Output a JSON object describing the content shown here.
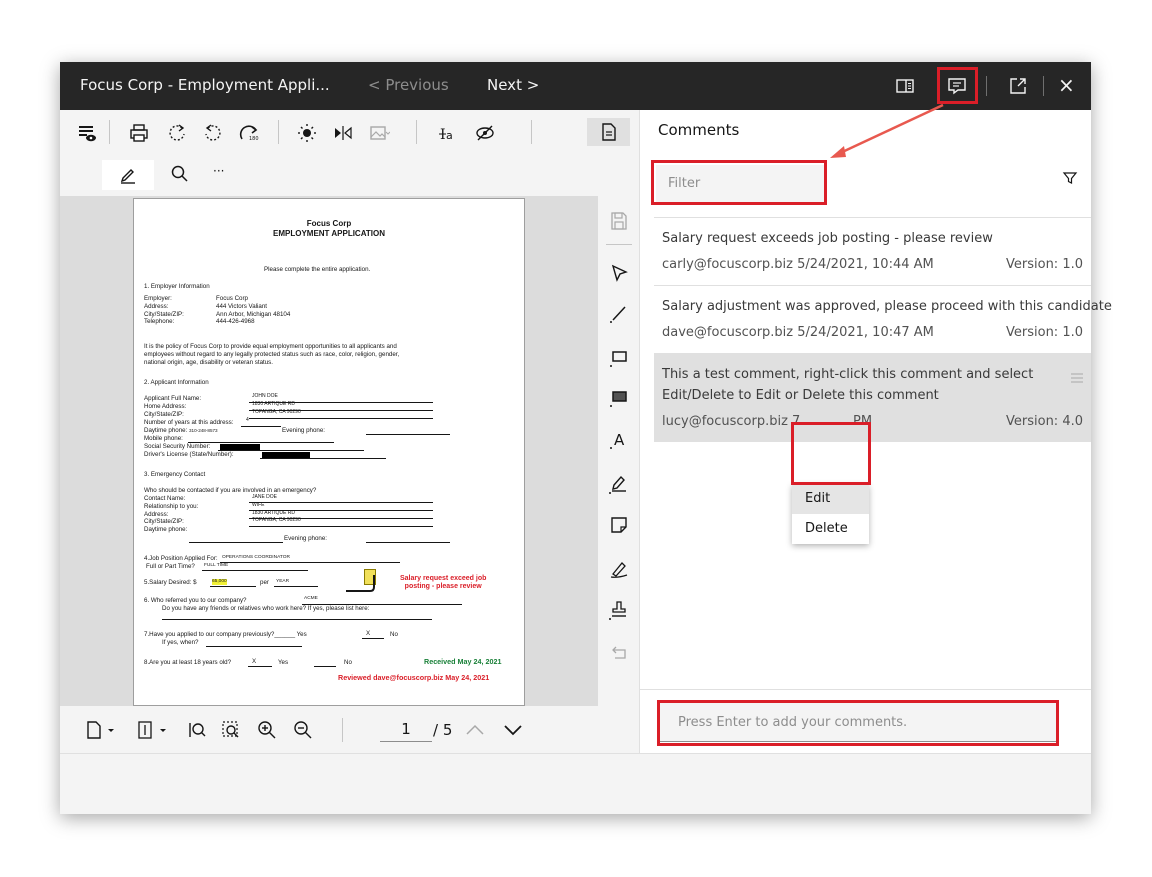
{
  "titlebar": {
    "title": "Focus Corp - Employment Appli...",
    "previous_label": "< Previous",
    "next_label": "Next >",
    "close_glyph": "×"
  },
  "toolbar": {
    "icons": [
      "annotation-visibility-icon",
      "print-icon",
      "rotate-clockwise-icon",
      "rotate-counterclockwise-icon",
      "rotate-180-icon",
      "brightness-icon",
      "flip-icon",
      "image-icon",
      "text-recognition-icon",
      "hide-icon",
      "document-properties-icon"
    ],
    "secondary": {
      "more_label": "···"
    }
  },
  "document": {
    "company": "Focus Corp",
    "heading": "EMPLOYMENT APPLICATION",
    "instruction": "Please complete the entire application.",
    "s1_title": "1.     Employer Information",
    "employer_labels": "Employer:\nAddress:\nCity/State/ZIP:\nTelephone:",
    "employer_values": "Focus Corp\n444 Victors Valiant\nAnn Arbor, Michigan 48104\n444-426-4968",
    "policy": "It is the policy of Focus Corp to provide equal employment opportunities to all applicants and\nemployees without regard to any legally protected status such as race, color, religion, gender,\nnational origin, age, disability or veteran status.",
    "s2_title": "2.     Applicant Information",
    "applicant_labels": "Applicant Full Name:\nHome Address:\nCity/State/ZIP:",
    "applicant_values": "JOHN DOE\n1830 ARTIQUE RD\nTOPANGA, CA 90290",
    "years_label": "Number of years at this address:",
    "years_value": "4",
    "daytime_label": "Daytime phone:",
    "daytime_value": "310-248-8573",
    "evening_label": "Evening phone:",
    "mobile_label": "Mobile phone:",
    "ssn_label": "Social Security Number:",
    "license_label": "Driver's License (State/Number):",
    "s3_title": "3.     Emergency Contact",
    "emergency_q": "Who should be contacted if you are involved in an emergency?",
    "emergency_labels": "Contact Name:\nRelationship to you:\nAddress:\nCity/State/ZIP:\nDaytime phone:",
    "emergency_values": "JANE DOE\nWIFE\n1830 ARTIQUE RD\nTOPANGA, CA 90290",
    "emergency_evening": "Evening phone:",
    "job_label": "4.Job Position Applied For:",
    "job_value": "OPERATIONS COORDINATOR",
    "time_label": "Full or Part Time?",
    "time_value": "FULL TIME",
    "salary_label": "5.Salary Desired:   $",
    "salary_value": "65,000",
    "salary_per": "per",
    "salary_unit": "YEAR",
    "salary_note": "Salary request exceed job\nposting - please review",
    "s6_line1": "6.      Who referred you to our company?",
    "s6_value": "ACME",
    "s6_line2": "Do you have any friends or relatives who work here? If yes, please list here:",
    "q7": "7.Have you applied to our company previously?______ Yes",
    "q7_x": "X",
    "q7_no": "No",
    "q7_when": "If yes, when?",
    "q8": "8.Are you at least 18 years old?",
    "q8_x": "X",
    "q8_yes": "Yes",
    "q8_no": "No",
    "stamp_received": "Received May 24, 2021",
    "stamp_reviewed": "Reviewed dave@focuscorp.biz May 24, 2021"
  },
  "pager": {
    "current": "1",
    "total": "/ 5"
  },
  "comments": {
    "title": "Comments",
    "filter_placeholder": "Filter",
    "items": [
      {
        "text": "Salary request exceeds job posting - please review",
        "author": "carly@focuscorp.biz 5/24/2021, 10:44 AM",
        "version": "Version: 1.0"
      },
      {
        "text": "Salary adjustment was approved, please proceed with this candidate",
        "author": "dave@focuscorp.biz 5/24/2021, 10:47 AM",
        "version": "Version: 1.0"
      },
      {
        "text": "This a test comment, right-click this comment and select Edit/Delete to Edit or Delete this comment",
        "author_prefix": "lucy@focuscorp.biz 7",
        "author_suffix": "PM",
        "version": "Version: 4.0"
      }
    ],
    "context_menu": [
      "Edit",
      "Delete"
    ],
    "add_placeholder": "Press Enter to add your comments."
  },
  "colors": {
    "titlebar": "#262626",
    "highlight": "#da1e28",
    "selected_comment": "#e0e0e0"
  }
}
